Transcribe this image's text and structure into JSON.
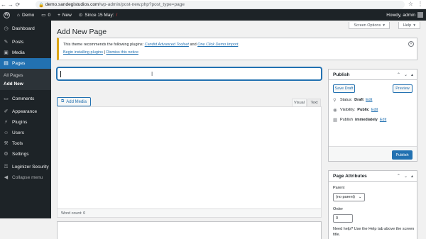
{
  "browser": {
    "url_host": "demo.sandegistudios.com",
    "url_path": "/wp-admin/post-new.php?post_type=page"
  },
  "adminbar": {
    "site": "Demo",
    "comments_count": "0",
    "new_label": "New",
    "since_label": "Since 15 May:",
    "since_value": "/",
    "howdy": "Howdy, admin"
  },
  "sidebar": {
    "items": [
      {
        "label": "Dashboard",
        "icon": "dashboard-icon"
      },
      {
        "label": "Posts",
        "icon": "pin-icon"
      },
      {
        "label": "Media",
        "icon": "media-icon"
      },
      {
        "label": "Pages",
        "icon": "page-icon"
      },
      {
        "label": "Comments",
        "icon": "comment-icon"
      },
      {
        "label": "Appearance",
        "icon": "brush-icon"
      },
      {
        "label": "Plugins",
        "icon": "plug-icon"
      },
      {
        "label": "Users",
        "icon": "user-icon"
      },
      {
        "label": "Tools",
        "icon": "wrench-icon"
      },
      {
        "label": "Settings",
        "icon": "settings-icon"
      },
      {
        "label": "Loginizer Security",
        "icon": "lock-icon"
      },
      {
        "label": "Collapse menu",
        "icon": "collapse-icon"
      }
    ],
    "pages_sub": [
      "All Pages",
      "Add New"
    ]
  },
  "header": {
    "screen_options": "Screen Options",
    "help": "Help",
    "title": "Add New Page"
  },
  "notice": {
    "text_before": "This theme recommends the following plugins:",
    "plugin1": "Candid Advanced Toolset",
    "and": "and",
    "plugin2": "One Click Demo Import",
    "period": ".",
    "begin": "Begin installing plugins",
    "sep": "|",
    "dismiss": "Dismiss this notice"
  },
  "editor": {
    "title_value": "",
    "add_media": "Add Media",
    "tab_visual": "Visual",
    "tab_text": "Text",
    "word_count": "Word count: 0"
  },
  "publish": {
    "title": "Publish",
    "save_draft": "Save Draft",
    "preview": "Preview",
    "status_label": "Status:",
    "status_value": "Draft",
    "visibility_label": "Visibility:",
    "visibility_value": "Public",
    "publish_label": "Publish",
    "publish_value": "immediately",
    "edit": "Edit",
    "publish_button": "Publish"
  },
  "attributes": {
    "title": "Page Attributes",
    "parent_label": "Parent",
    "parent_value": "(no parent)",
    "order_label": "Order",
    "order_value": "0",
    "help": "Need help? Use the Help tab above the screen title."
  },
  "colors": {
    "accent": "#2271b1",
    "adminbar": "#1d2327",
    "notice_border": "#dba617"
  }
}
